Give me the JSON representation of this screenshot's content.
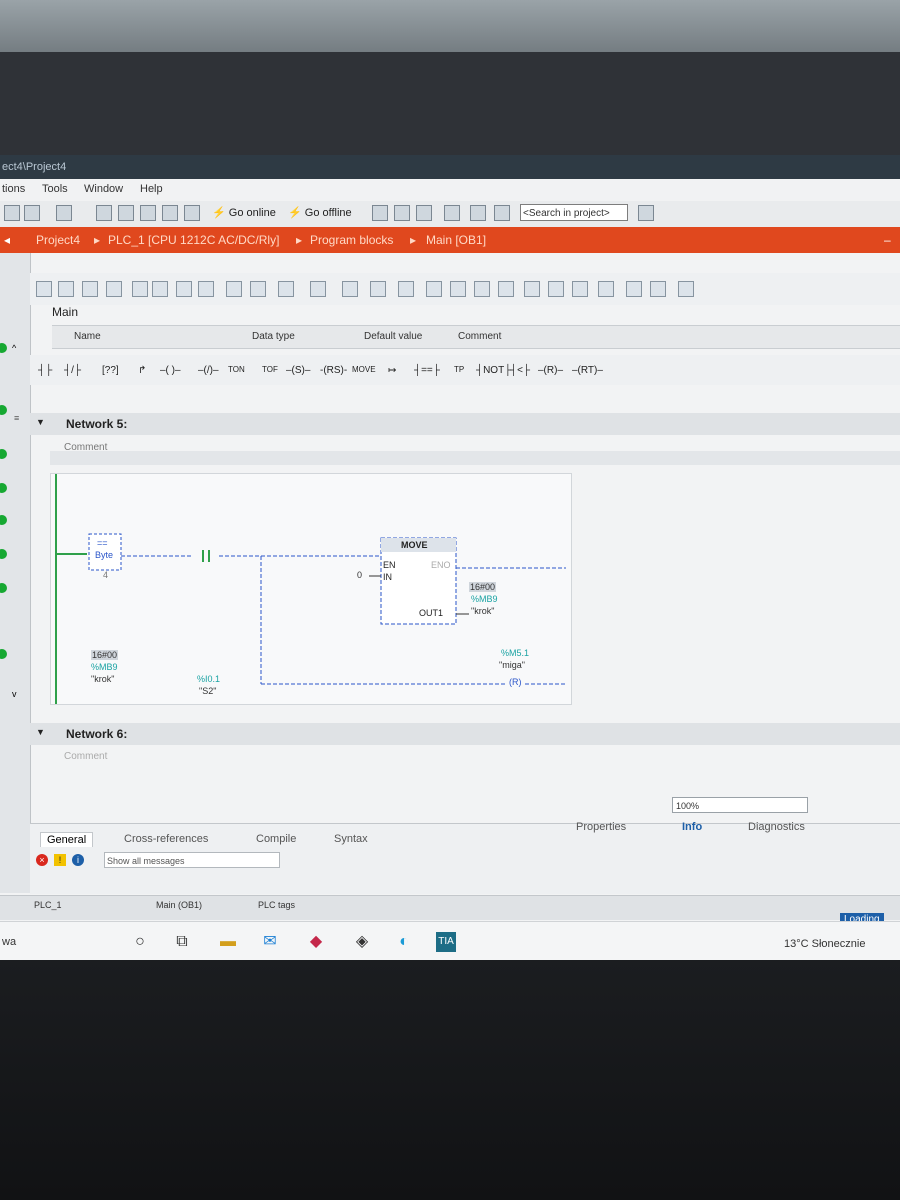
{
  "window": {
    "title": "ect4\\Project4"
  },
  "menu": [
    "tions",
    "Tools",
    "Window",
    "Help"
  ],
  "toolbar": {
    "go_online": "Go online",
    "go_offline": "Go offline",
    "search_placeholder": "<Search in project>"
  },
  "breadcrumb": [
    "Project4",
    "PLC_1 [CPU 1212C AC/DC/Rly]",
    "Program blocks",
    "Main [OB1]"
  ],
  "editor": {
    "block_title": "Main",
    "interface_columns": [
      "Name",
      "Data type",
      "Default value",
      "Comment"
    ]
  },
  "lad_toolbar": [
    "TON",
    "TOF",
    "MOVE",
    "TP"
  ],
  "network5": {
    "title": "Network 5:",
    "comment": "Comment",
    "compare": {
      "value": "16#00",
      "address": "%MB9",
      "tag": "\"krok\"",
      "op": "==",
      "type": "Byte",
      "operand2": "4"
    },
    "contact": {
      "address": "%I0.1",
      "tag": "\"S2\""
    },
    "move": {
      "title": "MOVE",
      "en": "EN",
      "eno": "ENO",
      "in": "IN",
      "in_value": "0",
      "out": "OUT1",
      "out_value": "16#00",
      "out_address": "%MB9",
      "out_tag": "\"krok\""
    },
    "reset": {
      "address": "%M5.1",
      "tag": "\"miga\"",
      "symbol": "R"
    }
  },
  "network6": {
    "title": "Network 6:",
    "comment": "Comment"
  },
  "zoom": "100%",
  "inspector_tabs": [
    "Properties",
    "Info",
    "Diagnostics"
  ],
  "bottom_tabs": [
    "General",
    "Cross-references",
    "Compile",
    "Syntax"
  ],
  "msg_filter": "Show all messages",
  "portal_tabs": [
    "PLC_1",
    "Main (OB1)",
    "PLC tags"
  ],
  "status": "Loading",
  "taskbar": {
    "search_text": "wa",
    "weather": "13°C Słonecznie"
  }
}
